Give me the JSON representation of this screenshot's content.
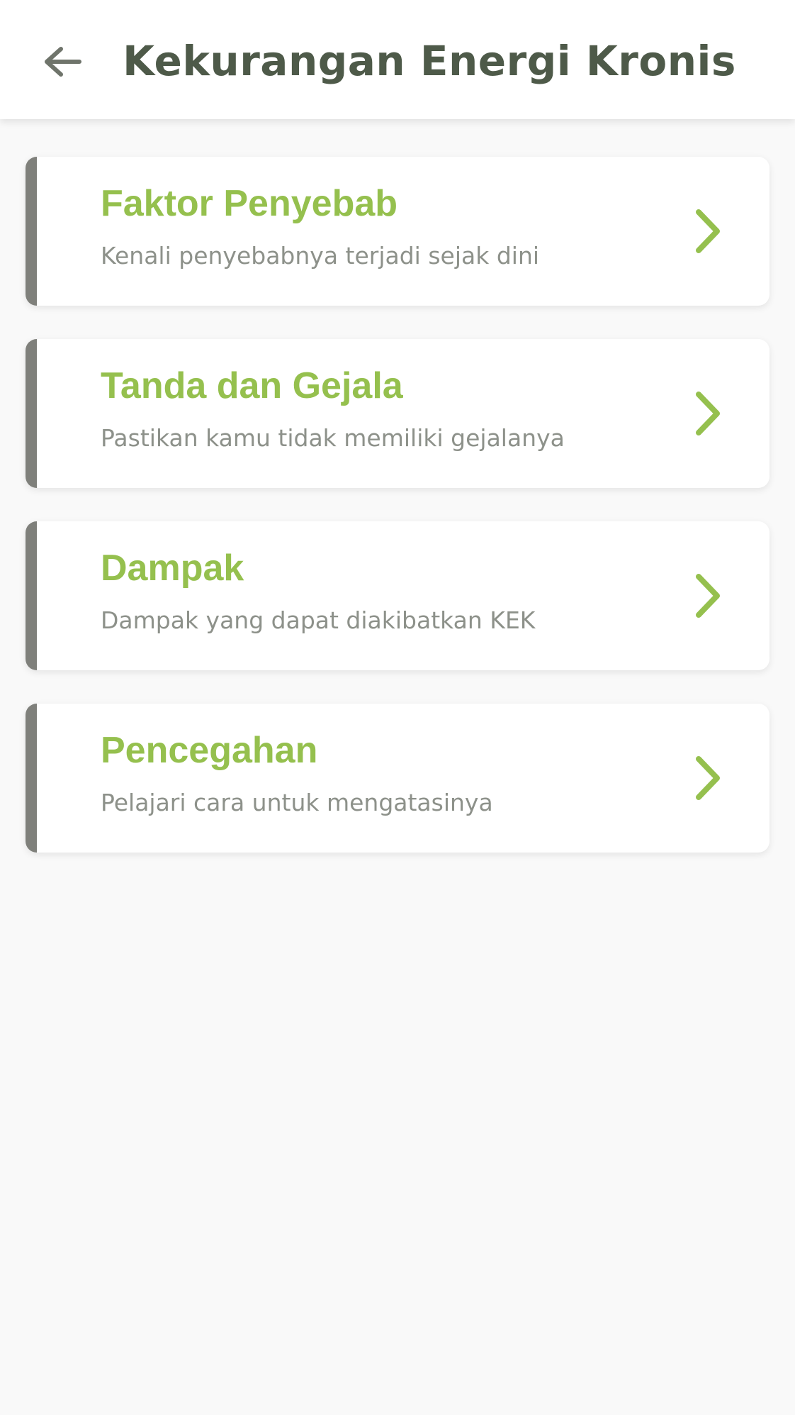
{
  "header": {
    "title": "Kekurangan Energi  Kronis",
    "back_icon": "arrow-left-icon"
  },
  "colors": {
    "title": "#4e5a49",
    "accent_green": "#95c04e",
    "card_bar": "#7f807b",
    "subtitle": "#8d918a",
    "background": "#f9f9f9"
  },
  "menu": {
    "items": [
      {
        "title": "Faktor Penyebab",
        "subtitle": "Kenali penyebabnya terjadi sejak dini",
        "icon": "chevron-right-icon"
      },
      {
        "title": "Tanda dan Gejala",
        "subtitle": "Pastikan kamu tidak memiliki gejalanya",
        "icon": "chevron-right-icon"
      },
      {
        "title": "Dampak",
        "subtitle": "Dampak yang dapat diakibatkan KEK",
        "icon": "chevron-right-icon"
      },
      {
        "title": "Pencegahan",
        "subtitle": "Pelajari cara untuk mengatasinya",
        "icon": "chevron-right-icon"
      }
    ]
  }
}
